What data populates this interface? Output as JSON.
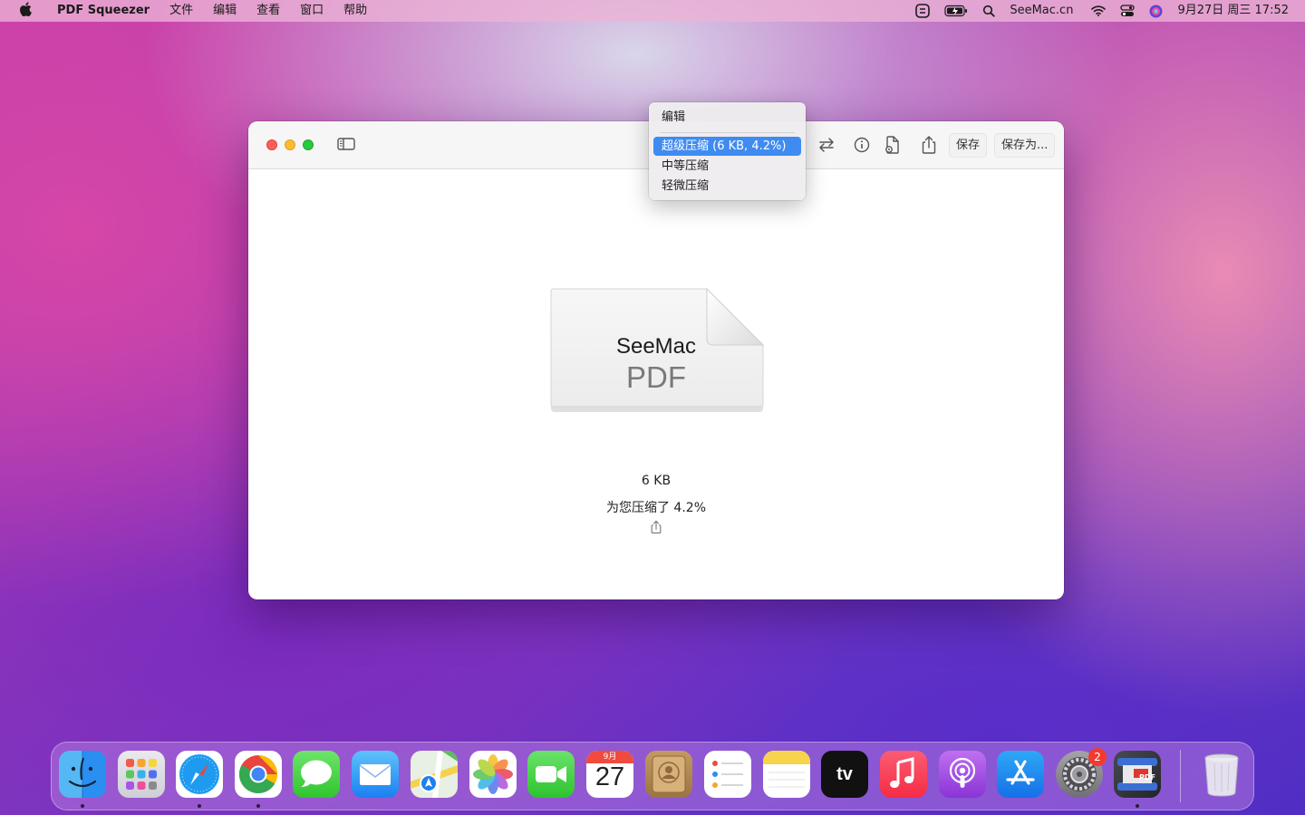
{
  "menubar": {
    "apple_icon": "apple-icon",
    "app_name": "PDF Squeezer",
    "menus": [
      "文件",
      "编辑",
      "查看",
      "窗口",
      "帮助"
    ],
    "right_text": "SeeMac.cn",
    "datetime": "9月27日 周三  17:52"
  },
  "window": {
    "toolbar": {
      "save_label": "保存",
      "save_as_label": "保存为..."
    },
    "document": {
      "title": "SeeMac",
      "type": "PDF"
    },
    "size_text": "6   KB",
    "ratio_text": "为您压缩了 4.2%"
  },
  "popup": {
    "header": "编辑",
    "options": [
      "超级压缩 (6 KB, 4.2%)",
      "中等压缩",
      "轻微压缩"
    ],
    "selected_option": "超级压缩 (6 KB, 4.2%)"
  },
  "dock": {
    "apps": [
      "Finder",
      "Launchpad",
      "Safari",
      "Chrome",
      "Messages",
      "Mail",
      "Maps",
      "Photos",
      "FaceTime",
      "Calendar",
      "Contacts",
      "Reminders",
      "Notes",
      "TV",
      "Music",
      "Podcasts",
      "App Store",
      "System Preferences",
      "PDF Squeezer",
      "Trash"
    ],
    "calendar_month": "9月",
    "calendar_day": "27",
    "tv_label": "tv",
    "pdf_label": "PDF",
    "settings_badge": "2"
  },
  "colors": {
    "accent": "#3f8bf2",
    "close": "#fe5f57",
    "minimize": "#febc2e",
    "maximize": "#28c840"
  }
}
